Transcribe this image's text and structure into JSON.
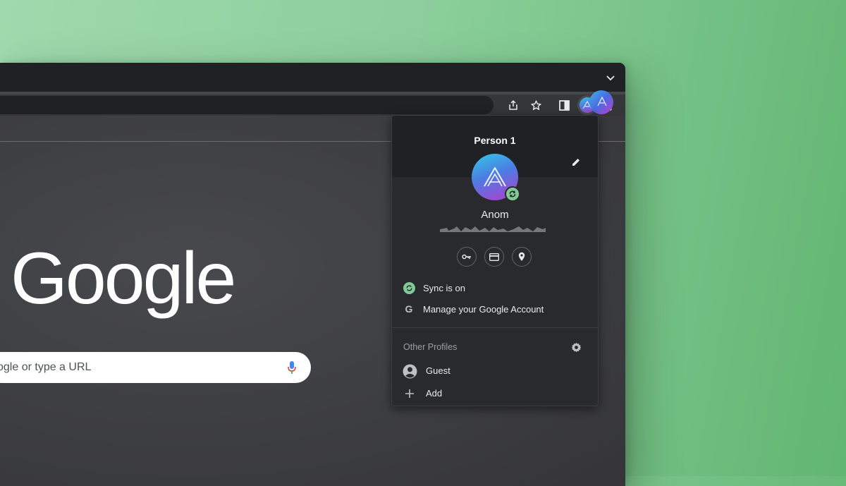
{
  "browser": {
    "tabstrip": {
      "tab_search_icon": "chevron-down-icon"
    },
    "toolbar": {
      "icons": [
        "share-icon",
        "bookmark-star-icon",
        "side-panel-icon",
        "profile-avatar-icon",
        "kebab-menu-icon"
      ]
    },
    "page": {
      "logo_text": "Google",
      "search_placeholder": "ogle or type a URL",
      "mic_icon": "microphone-icon"
    }
  },
  "profile_menu": {
    "title": "Person 1",
    "account_name": "Anom",
    "quick_actions": [
      "key-icon",
      "credit-card-icon",
      "location-pin-icon"
    ],
    "items": [
      {
        "icon": "sync-icon",
        "label": "Sync is on"
      },
      {
        "icon": "google-g-icon",
        "label": "Manage your Google Account"
      }
    ],
    "other_profiles": {
      "title": "Other Profiles",
      "items": [
        {
          "icon": "person-circle-icon",
          "label": "Guest"
        },
        {
          "icon": "plus-icon",
          "label": "Add"
        }
      ]
    }
  },
  "colors": {
    "background": "#8ccf9c",
    "window_bg": "#353538",
    "popup_bg": "#292a2d",
    "popup_header_bg": "#202124",
    "sync_green": "#81c995",
    "text_primary": "#e8eaed",
    "text_secondary": "#9aa0a6"
  }
}
